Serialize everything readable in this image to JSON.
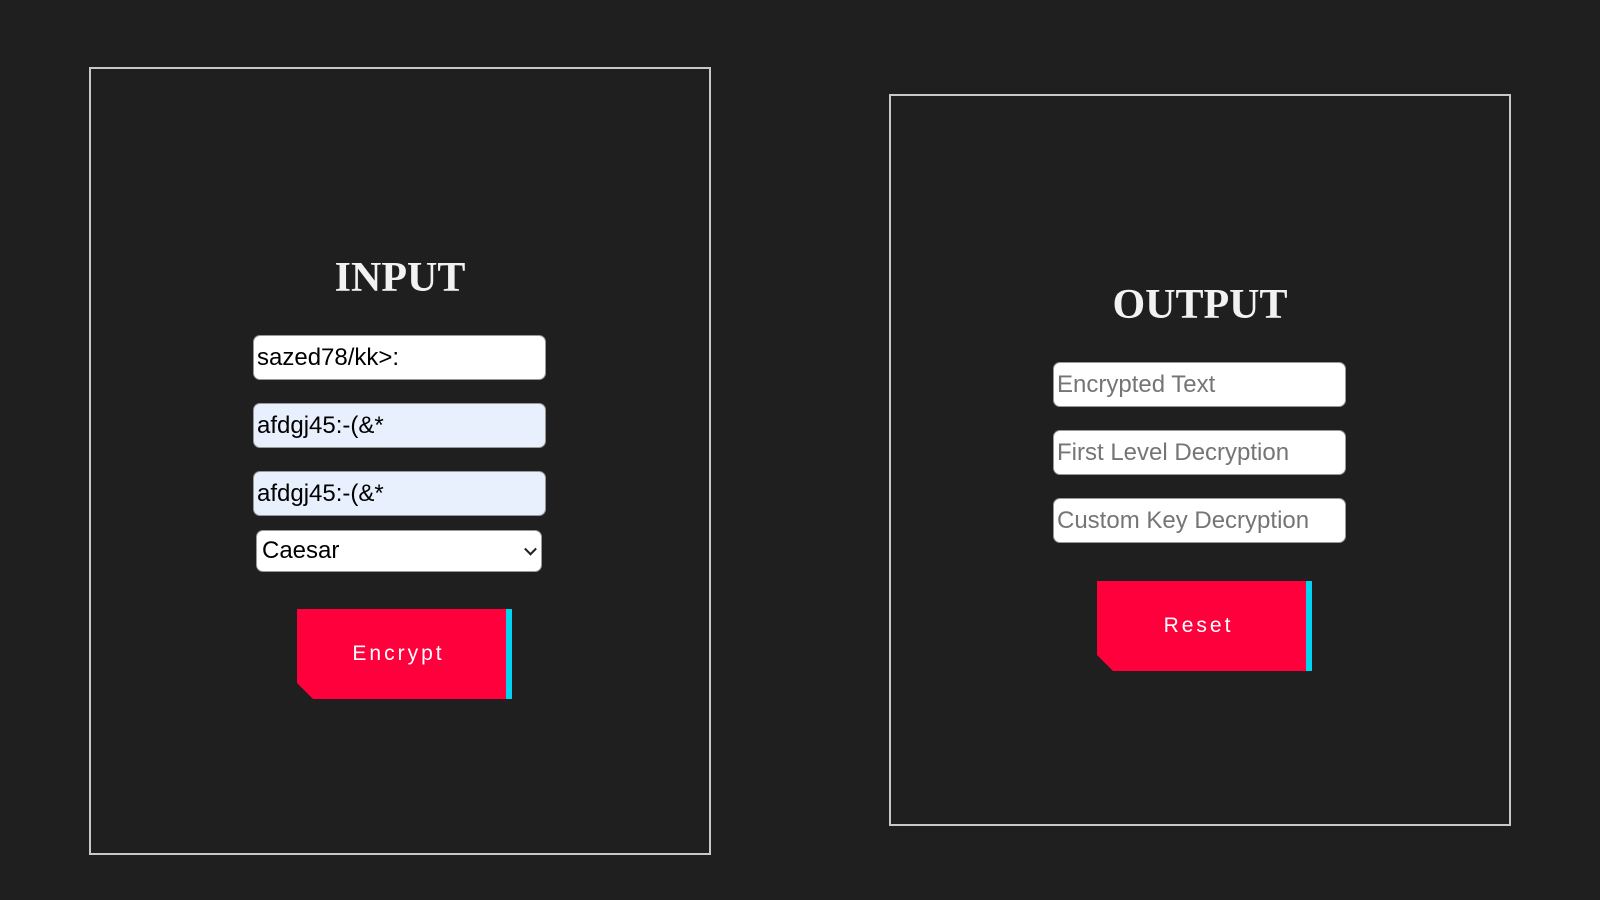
{
  "input_panel": {
    "title": "INPUT",
    "plain_text_value": "sazed78/kk>:",
    "key_value": "afdgj45:-(&*",
    "confirm_key_value": "afdgj45:-(&*",
    "algorithm_select": {
      "selected": "Caesar",
      "icon": "chevron-down-icon"
    },
    "encrypt_label": "Encrypt"
  },
  "output_panel": {
    "title": "OUTPUT",
    "encrypted_placeholder": "Encrypted Text",
    "first_level_placeholder": "First Level Decryption",
    "custom_key_placeholder": "Custom Key Decryption",
    "reset_label": "Reset"
  },
  "colors": {
    "background": "#1f1f1f",
    "panel_border": "#c8c8c8",
    "button": "#ff003c",
    "button_accent": "#00d4ee",
    "autofill_field": "#e8f0fe"
  }
}
